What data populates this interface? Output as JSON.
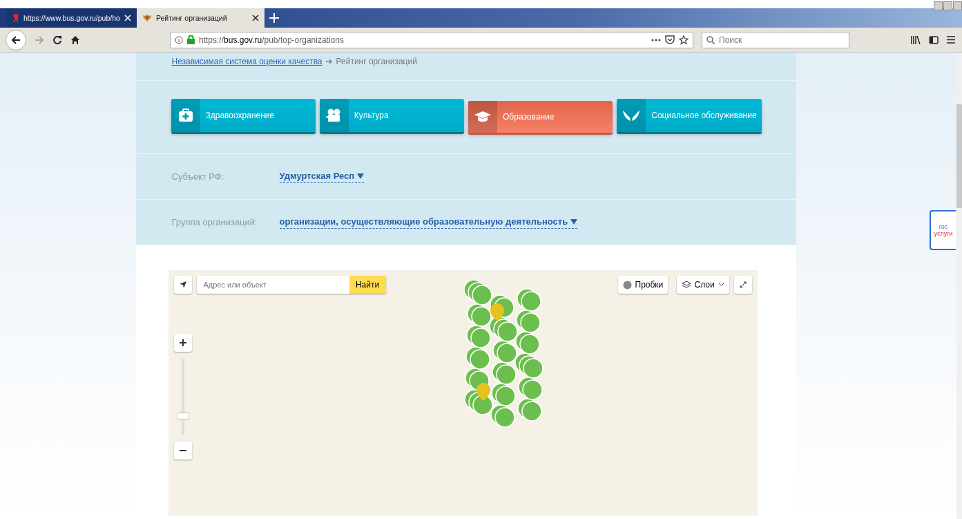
{
  "browser": {
    "tabs": [
      {
        "label": "https://www.bus.gov.ru/pub/ho",
        "selected": false
      },
      {
        "label": "Рейтинг организаций",
        "selected": true
      }
    ],
    "url": {
      "scheme": "https://",
      "domain": "bus.gov.ru",
      "path": "/pub/top-organizations"
    },
    "search_placeholder": "Поиск"
  },
  "breadcrumb": {
    "link": "Независимая система оценки качества",
    "current": "Рейтинг организаций"
  },
  "categories": [
    {
      "label": "Здравоохранение",
      "selected": false
    },
    {
      "label": "Культура",
      "selected": false
    },
    {
      "label": "Образование",
      "selected": true
    },
    {
      "label": "Социальное обслуживание",
      "selected": false
    }
  ],
  "filters": [
    {
      "label": "Субъект РФ:",
      "value": "Удмуртская Респ"
    },
    {
      "label": "Группа организаций:",
      "value": "организации, осуществляющие образовательную деятельность"
    }
  ],
  "map": {
    "search_placeholder": "Адрес или объект",
    "search_button": "Найти",
    "traffic_button": "Пробки",
    "layers_button": "Слои"
  },
  "side_badge": {
    "line1": "гос",
    "line2": "услуги"
  }
}
